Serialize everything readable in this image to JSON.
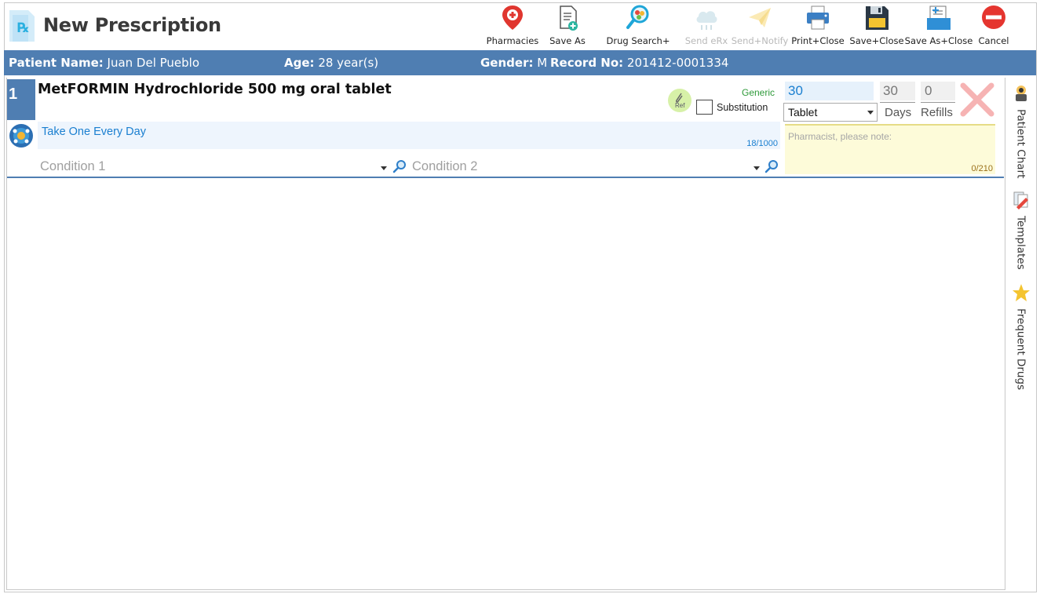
{
  "window": {
    "title": "New Prescription"
  },
  "toolbar": [
    {
      "label": "Pharmacies",
      "icon": "pharmacy-pin-icon",
      "enabled": true
    },
    {
      "label": "Save As",
      "icon": "save-as-document-icon",
      "enabled": true
    },
    {
      "label": "Drug Search+",
      "icon": "drug-search-icon",
      "enabled": true
    },
    {
      "label": "Send eRx",
      "icon": "cloud-send-icon",
      "enabled": false
    },
    {
      "label": "Send+Notify",
      "icon": "paper-plane-icon",
      "enabled": false
    },
    {
      "label": "Print+Close",
      "icon": "printer-icon",
      "enabled": true
    },
    {
      "label": "Save+Close",
      "icon": "floppy-disk-icon",
      "enabled": true
    },
    {
      "label": "Save As+Close",
      "icon": "save-as-close-icon",
      "enabled": true
    },
    {
      "label": "Cancel",
      "icon": "cancel-icon",
      "enabled": true
    }
  ],
  "patient": {
    "name_label": "Patient Name:",
    "name": "Juan Del Pueblo",
    "age_label": "Age:",
    "age": "28 year(s)",
    "gender_label": "Gender:",
    "gender": "M",
    "record_label": "Record No:",
    "record_no": "201412-0001334"
  },
  "prescription": {
    "number": "1",
    "drug_name": "MetFORMIN Hydrochloride 500 mg oral tablet",
    "ref_label": "Ref",
    "generic_label": "Generic",
    "substitution_label": "Substitution",
    "substitution_checked": false,
    "quantity": "30",
    "form": "Tablet",
    "days": "30",
    "days_label": "Days",
    "refills": "0",
    "refills_label": "Refills",
    "sig": "Take One Every Day",
    "sig_count": "18/1000",
    "pharmacist_note_placeholder": "Pharmacist, please note:",
    "note_count": "0/210",
    "condition1_placeholder": "Condition 1",
    "condition2_placeholder": "Condition 2"
  },
  "side_panel": [
    {
      "label": "Patient Chart",
      "icon": "patient-chart-icon"
    },
    {
      "label": "Templates",
      "icon": "templates-icon"
    },
    {
      "label": "Frequent Drugs",
      "icon": "star-icon"
    }
  ],
  "colors": {
    "accent": "#4f7eb2",
    "link_blue": "#1a7fd0",
    "generic_green": "#2f9a3a",
    "remove_red": "#f6b3b3"
  }
}
